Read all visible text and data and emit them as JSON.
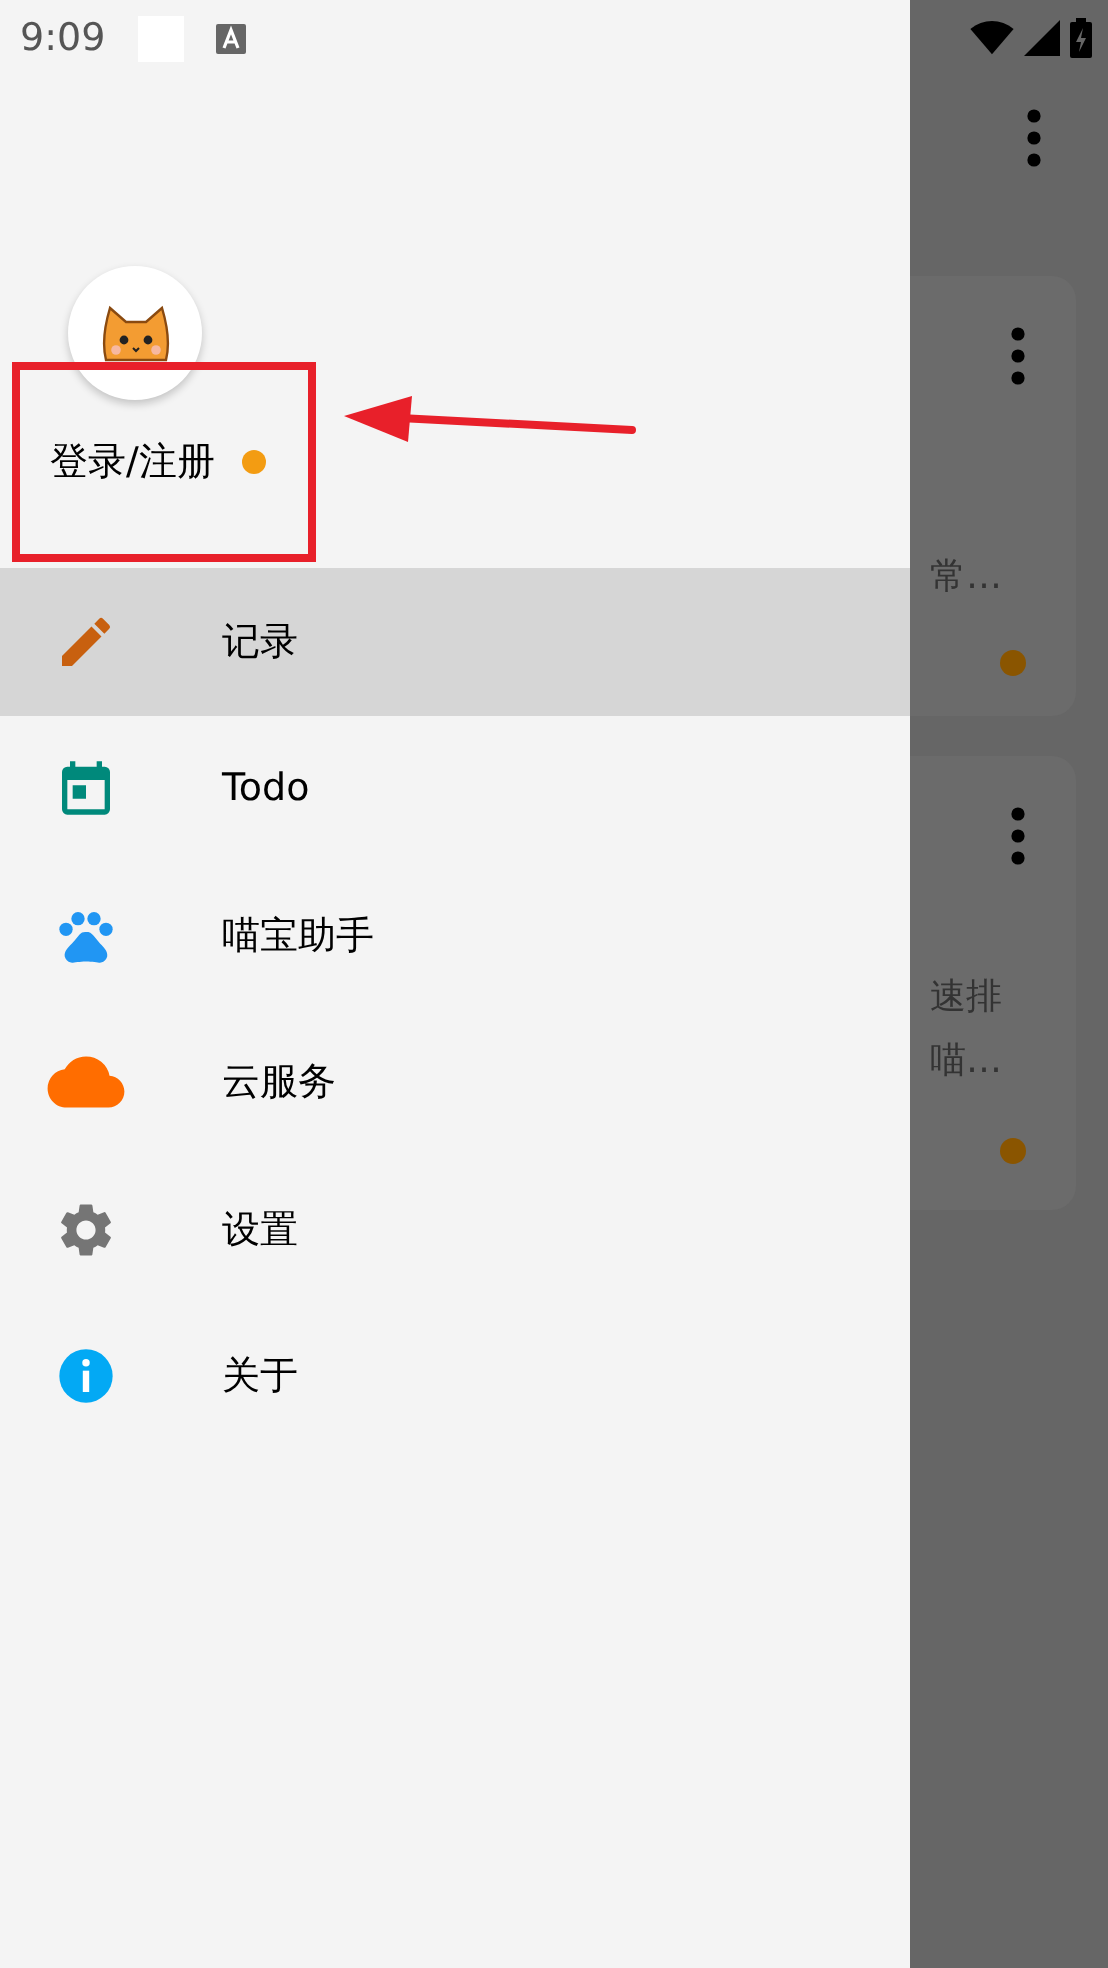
{
  "status_bar": {
    "time": "9:09"
  },
  "account": {
    "label": "登录/注册",
    "notice_dot": true
  },
  "menu": [
    {
      "kind": "pencil",
      "label": "记录",
      "selected": true
    },
    {
      "kind": "calendar",
      "label": "Todo",
      "selected": false
    },
    {
      "kind": "paw",
      "label": "喵宝助手",
      "selected": false
    },
    {
      "kind": "cloud",
      "label": "云服务",
      "selected": false
    },
    {
      "kind": "gear",
      "label": "设置",
      "selected": false
    },
    {
      "kind": "info",
      "label": "关于",
      "selected": false
    }
  ],
  "background_cards": [
    {
      "lines": [
        "常…"
      ],
      "color": "#8a5500"
    },
    {
      "lines": [
        "速排",
        "喵…"
      ],
      "color": "#8a5500"
    }
  ]
}
